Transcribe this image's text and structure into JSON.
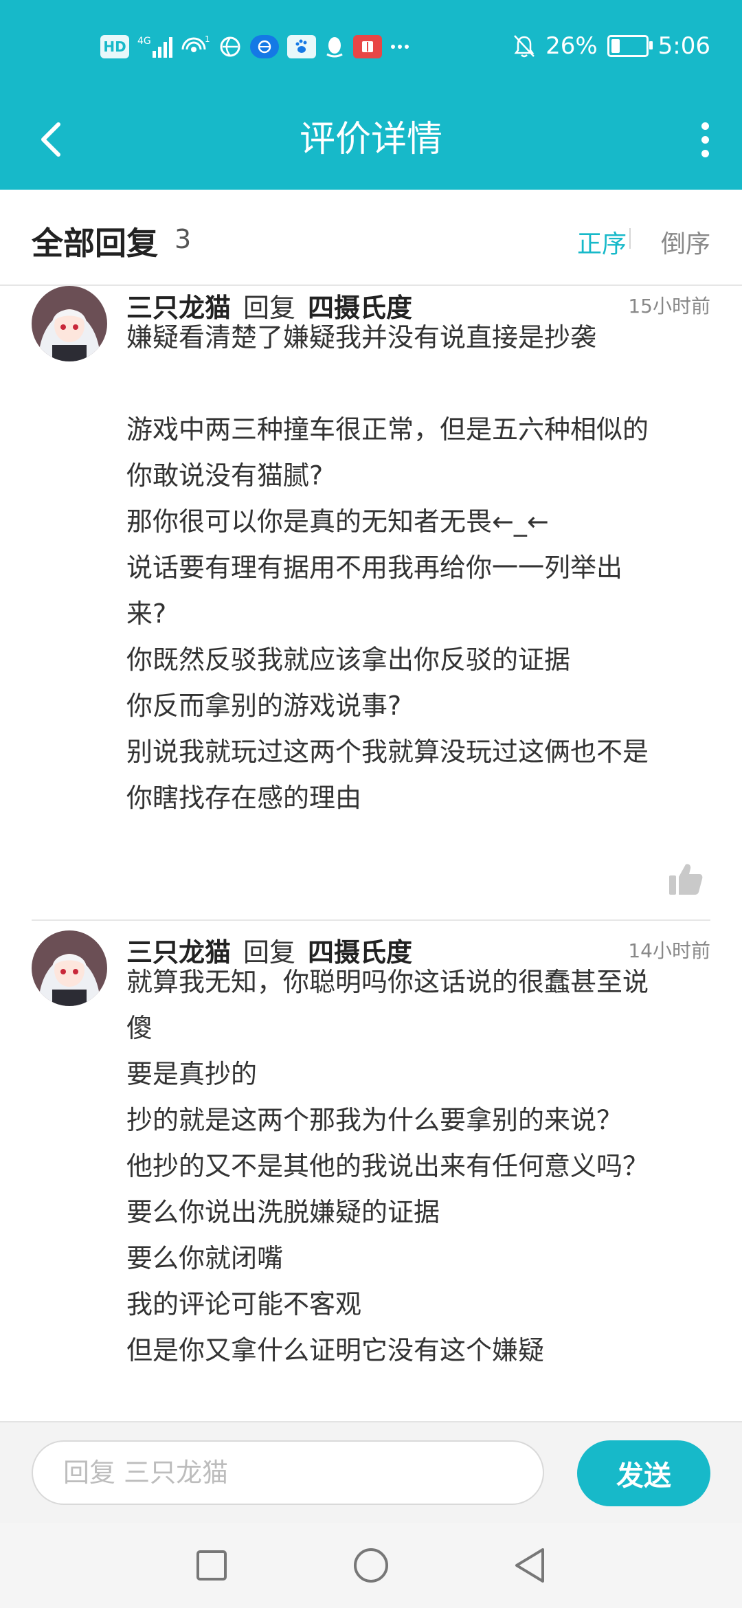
{
  "status_bar": {
    "left_icons": [
      "hd-icon",
      "4g-signal-icon",
      "hotspot-icon",
      "vpn-icon",
      "browser-icon",
      "baidu-icon",
      "qq-icon",
      "reader-icon",
      "more-dots-icon"
    ],
    "hd_label": "HD",
    "network_label": "4G",
    "hotspot_count": "1",
    "battery_percent": "26%",
    "battery_level": 0.26,
    "time": "5:06"
  },
  "nav": {
    "title": "评价详情"
  },
  "header": {
    "title": "全部回复",
    "count": "3",
    "sort_asc": "正序",
    "sort_desc": "倒序"
  },
  "comments": [
    {
      "user": "三只龙猫",
      "reply_word": "回复",
      "target": "四摄氏度",
      "time": "15小时前",
      "lines": [
        "嫌疑看清楚了嫌疑我并没有说直接是抄袭",
        "",
        "游戏中两三种撞车很正常，但是五六种相似的",
        "你敢说没有猫腻?",
        "那你很可以你是真的无知者无畏←_←",
        "说话要有理有据用不用我再给你一一列举出",
        "来?",
        "你既然反驳我就应该拿出你反驳的证据",
        "你反而拿别的游戏说事?",
        "别说我就玩过这两个我就算没玩过这俩也不是",
        "你瞎找存在感的理由"
      ]
    },
    {
      "user": "三只龙猫",
      "reply_word": "回复",
      "target": "四摄氏度",
      "time": "14小时前",
      "lines": [
        "就算我无知，你聪明吗你这话说的很蠢甚至说",
        "傻",
        "要是真抄的",
        "抄的就是这两个那我为什么要拿别的来说？",
        "他抄的又不是其他的我说出来有任何意义吗？",
        "要么你说出洗脱嫌疑的证据",
        "要么你就闭嘴",
        "我的评论可能不客观",
        "但是你又拿什么证明它没有这个嫌疑"
      ]
    }
  ],
  "input": {
    "placeholder": "回复 三只龙猫",
    "value": "",
    "send_label": "发送"
  },
  "colors": {
    "accent": "#17b9c9",
    "text": "#333333",
    "muted": "#888888"
  }
}
